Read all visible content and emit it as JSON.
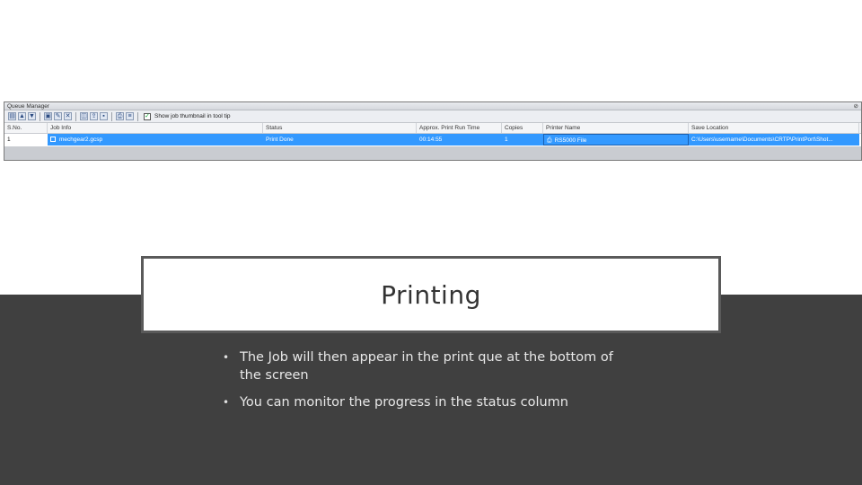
{
  "queue_manager": {
    "title": "Queue Manager",
    "pin_icon": "pin-icon",
    "toolbar": {
      "checkbox_checked": true,
      "checkbox_label": "Show job thumbnail in tool tip"
    },
    "columns": [
      "S.No.",
      "Job Info",
      "Status",
      "Approx. Print Run Time",
      "Copies",
      "Printer Name",
      "Save Location"
    ],
    "rows": [
      {
        "sno": "1",
        "job_info": "mechgear2.gcsp",
        "status": "Print Done",
        "time": "00:14:55",
        "copies": "1",
        "printer": "RS5000 File",
        "save_location": "C:\\Users\\username\\Documents\\CRTP\\PrintPort\\Shot..."
      }
    ],
    "colors": {
      "selection": "#3399ff"
    }
  },
  "slide": {
    "title": "Printing",
    "bullets": [
      "The Job will then appear in the print que at the bottom of the screen",
      "You can monitor the progress in the status column"
    ],
    "colors": {
      "dark_band": "#404040",
      "title_border": "#5a5a5a"
    }
  }
}
